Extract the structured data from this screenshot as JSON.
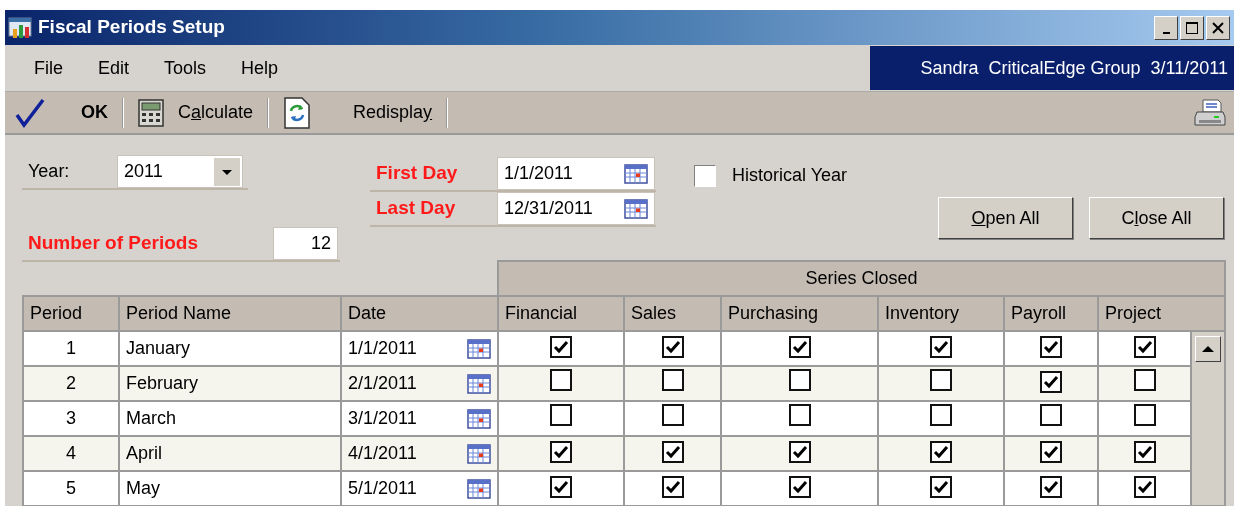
{
  "window": {
    "title": "Fiscal Periods Setup"
  },
  "menu": [
    {
      "label": "File"
    },
    {
      "label": "Edit"
    },
    {
      "label": "Tools"
    },
    {
      "label": "Help"
    }
  ],
  "user_info": {
    "user": "Sandra",
    "company": "CriticalEdge Group",
    "date": "3/11/2011"
  },
  "toolbar": [
    {
      "kind": "ok",
      "label": "OK"
    },
    {
      "kind": "calculate",
      "label": {
        "before": "C",
        "key": "a",
        "after": "lculate"
      }
    },
    {
      "kind": "redisplay",
      "label": {
        "before": "Redispla",
        "key": "y"
      }
    }
  ],
  "form": {
    "year_label": "Year:",
    "year": "2011",
    "first_day_label": "First Day",
    "first_day": "1/1/2011",
    "last_day_label": "Last Day",
    "last_day": "12/31/2011",
    "historical_year": {
      "label": "Historical Year",
      "checked": false
    },
    "periods_label": "Number of Periods",
    "periods": "12"
  },
  "buttons": [
    {
      "label": {
        "key": "O",
        "after": "pen All"
      }
    },
    {
      "label": {
        "before": "C",
        "key": "l",
        "after": "ose All"
      }
    }
  ],
  "table": {
    "group_header": "Series Closed",
    "columns": [
      "Period",
      "Period Name",
      "Date",
      "Financial",
      "Sales",
      "Purchasing",
      "Inventory",
      "Payroll",
      "Project"
    ],
    "rows": [
      {
        "period": "1",
        "name": "January",
        "date": "1/1/2011",
        "closed": [
          true,
          true,
          true,
          true,
          true,
          true
        ]
      },
      {
        "period": "2",
        "name": "February",
        "date": "2/1/2011",
        "closed": [
          false,
          false,
          false,
          false,
          true,
          false
        ]
      },
      {
        "period": "3",
        "name": "March",
        "date": "3/1/2011",
        "closed": [
          false,
          false,
          false,
          false,
          false,
          false
        ]
      },
      {
        "period": "4",
        "name": "April",
        "date": "4/1/2011",
        "closed": [
          true,
          true,
          true,
          true,
          true,
          true
        ]
      },
      {
        "period": "5",
        "name": "May",
        "date": "5/1/2011",
        "closed": [
          true,
          true,
          true,
          true,
          true,
          true
        ]
      }
    ]
  }
}
